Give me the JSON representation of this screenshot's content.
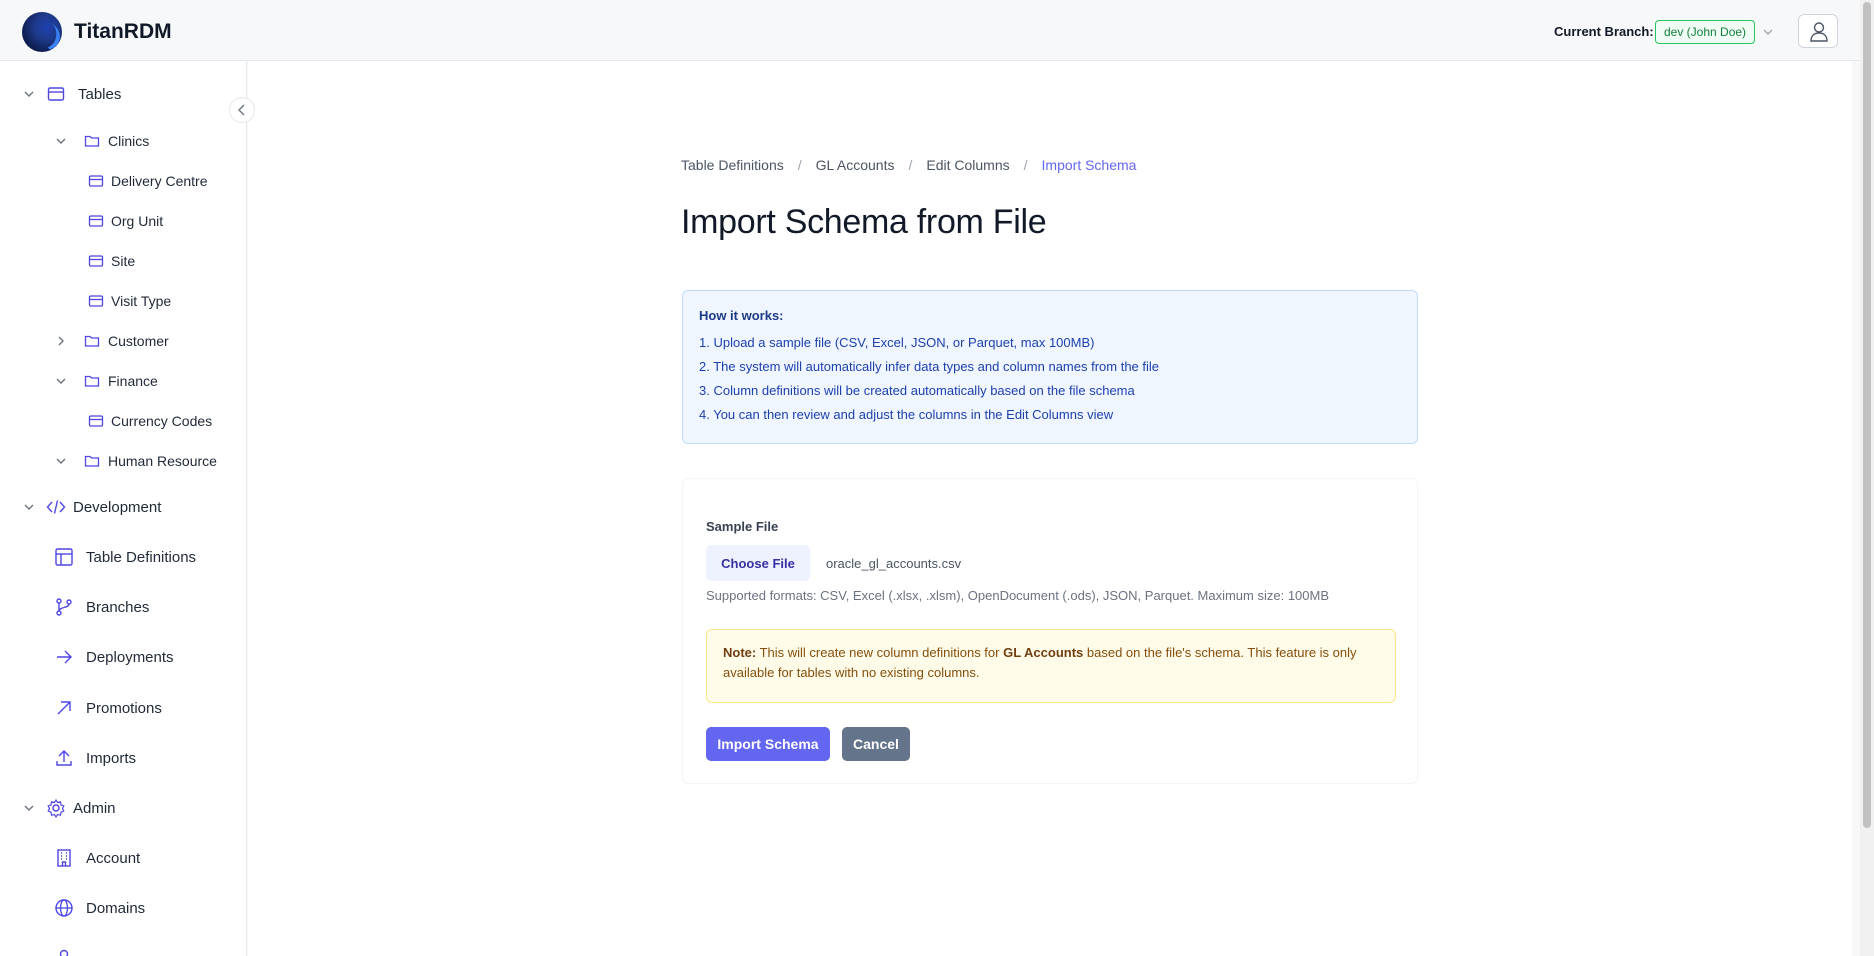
{
  "app": {
    "title": "TitanRDM"
  },
  "header": {
    "branch_label": "Current Branch:",
    "branch_value": "dev (John Doe)",
    "user_icon": "user-icon",
    "branch_color": "#15803d"
  },
  "sidebar": {
    "tables": {
      "label": "Tables",
      "groups": [
        {
          "label": "Clinics",
          "expanded": true,
          "items": [
            "Delivery Centre",
            "Org Unit",
            "Site",
            "Visit Type"
          ]
        },
        {
          "label": "Customer",
          "expanded": false,
          "items": []
        },
        {
          "label": "Finance",
          "expanded": true,
          "items": [
            "Currency Codes"
          ]
        },
        {
          "label": "Human Resource",
          "expanded": true,
          "items": []
        }
      ]
    },
    "development": {
      "label": "Development",
      "items": [
        "Table Definitions",
        "Branches",
        "Deployments",
        "Promotions",
        "Imports"
      ]
    },
    "admin": {
      "label": "Admin",
      "items": [
        "Account",
        "Domains"
      ]
    }
  },
  "breadcrumb": {
    "items": [
      "Table Definitions",
      "GL Accounts",
      "Edit Columns"
    ],
    "current": "Import Schema"
  },
  "page": {
    "title": "Import Schema from File"
  },
  "how_it_works": {
    "title": "How it works:",
    "steps": [
      "1. Upload a sample file (CSV, Excel, JSON, or Parquet, max 100MB)",
      "2. The system will automatically infer data types and column names from the file",
      "3. Column definitions will be created automatically based on the file schema",
      "4. You can then review and adjust the columns in the Edit Columns view"
    ]
  },
  "form": {
    "field_label": "Sample File",
    "choose_button": "Choose File",
    "file_name": "oracle_gl_accounts.csv",
    "help": "Supported formats: CSV, Excel (.xlsx, .xlsm), OpenDocument (.ods), JSON, Parquet. Maximum size: 100MB",
    "note_label": "Note:",
    "note_text_1": " This will create new column definitions for ",
    "note_table": "GL Accounts",
    "note_text_2": " based on the file's schema. This feature is only available for tables with no existing columns.",
    "import_button": "Import Schema",
    "cancel_button": "Cancel"
  },
  "colors": {
    "accent": "#6366f1",
    "info_bg": "#eff6ff",
    "note_bg": "#fefce8"
  }
}
